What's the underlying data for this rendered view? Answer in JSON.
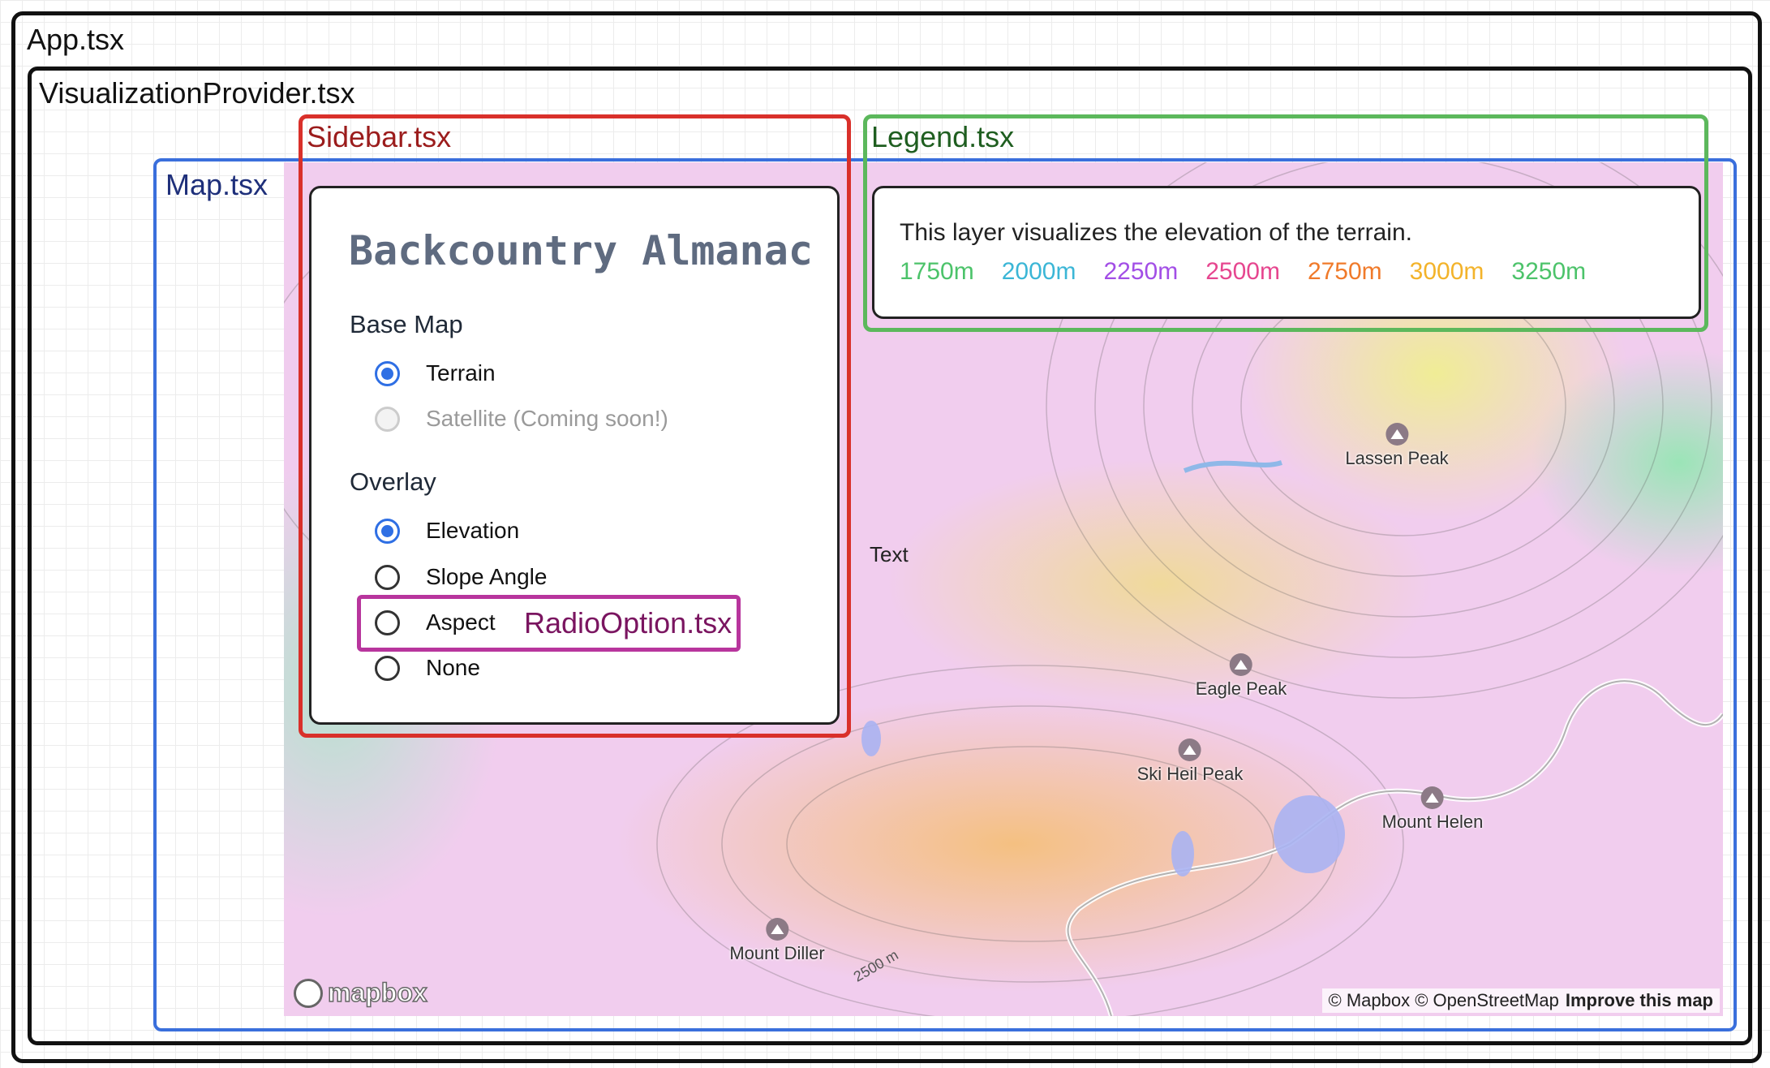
{
  "components": {
    "app": "App.tsx",
    "visualization_provider": "VisualizationProvider.tsx",
    "map": "Map.tsx",
    "sidebar": "Sidebar.tsx",
    "legend": "Legend.tsx",
    "radio_option": "RadioOption.tsx"
  },
  "sidebar": {
    "title": "Backcountry Almanac",
    "base_map": {
      "title": "Base Map",
      "options": [
        {
          "label": "Terrain",
          "checked": true,
          "disabled": false
        },
        {
          "label": "Satellite (Coming soon!)",
          "checked": false,
          "disabled": true
        }
      ]
    },
    "overlay": {
      "title": "Overlay",
      "options": [
        {
          "label": "Elevation",
          "checked": true
        },
        {
          "label": "Slope Angle",
          "checked": false
        },
        {
          "label": "Aspect",
          "checked": false
        },
        {
          "label": "None",
          "checked": false
        }
      ]
    }
  },
  "legend": {
    "description": "This layer visualizes the elevation of the terrain.",
    "items": [
      {
        "label": "1750m",
        "color": "#4cc36a"
      },
      {
        "label": "2000m",
        "color": "#3bb6d6"
      },
      {
        "label": "2250m",
        "color": "#a24ee6"
      },
      {
        "label": "2500m",
        "color": "#e6468f"
      },
      {
        "label": "2750m",
        "color": "#f07a2a"
      },
      {
        "label": "3000m",
        "color": "#f3b32a"
      },
      {
        "label": "3250m",
        "color": "#4cc36a"
      }
    ]
  },
  "map": {
    "text_label": "Text",
    "contour_label": "2500 m",
    "peaks": [
      {
        "name": "Lassen Peak"
      },
      {
        "name": "Eagle Peak"
      },
      {
        "name": "Ski Heil Peak"
      },
      {
        "name": "Mount Helen"
      },
      {
        "name": "Mount Diller"
      }
    ],
    "logo": "mapbox",
    "attribution": "© Mapbox © OpenStreetMap",
    "improve_link": "Improve this map"
  },
  "colors": {
    "app_border": "#111111",
    "map_border": "#3a6fdc",
    "sidebar_border": "#d9302a",
    "legend_border": "#5cb85c",
    "radio_option_border": "#b8359d",
    "radio_accent": "#2f6fe4"
  }
}
